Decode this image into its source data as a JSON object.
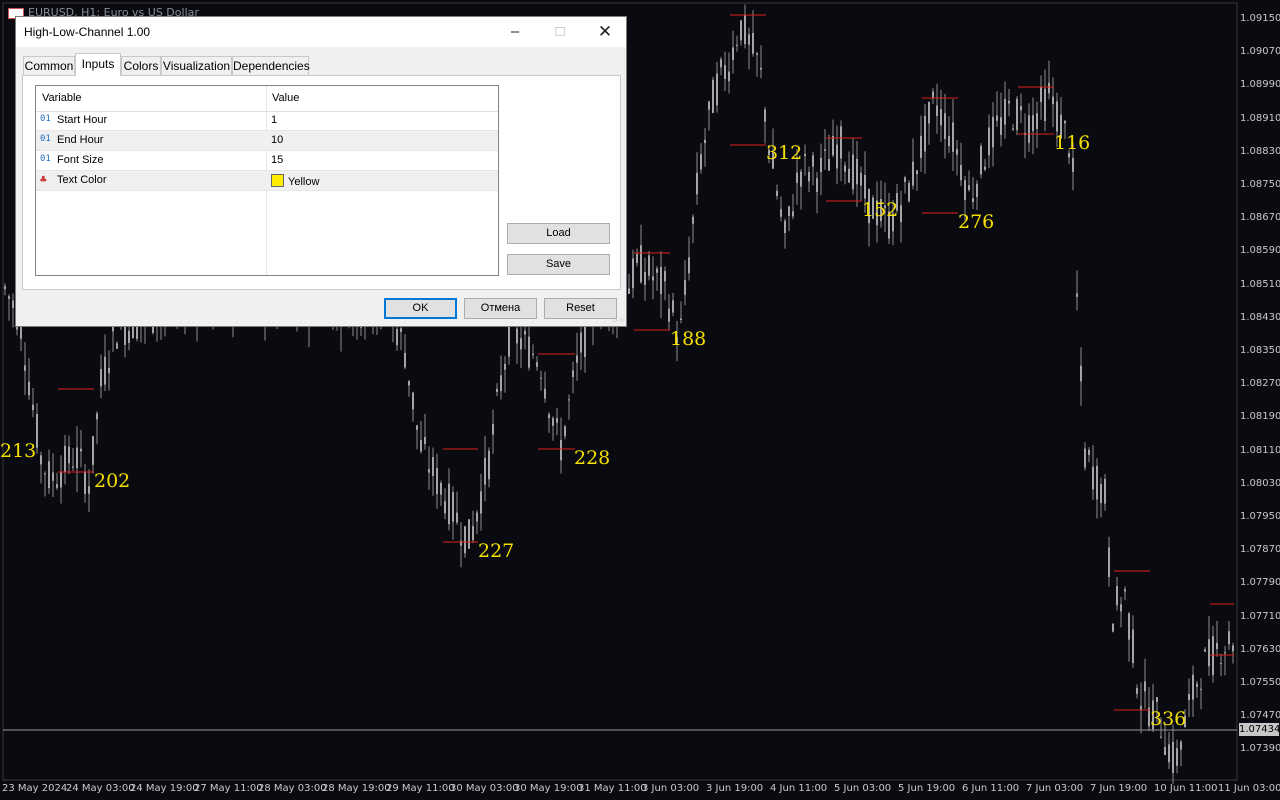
{
  "chart": {
    "window_title": "EURUSD, H1: Euro vs US Dollar",
    "current_price": "1.07434",
    "y_ticks": [
      "1.09150",
      "1.09070",
      "1.08990",
      "1.08910",
      "1.08830",
      "1.08750",
      "1.08670",
      "1.08590",
      "1.08510",
      "1.08430",
      "1.08350",
      "1.08270",
      "1.08190",
      "1.08110",
      "1.08030",
      "1.07950",
      "1.07870",
      "1.07790",
      "1.07710",
      "1.07630",
      "1.07550",
      "1.07470",
      "1.07390"
    ],
    "x_ticks": [
      "23 May 2024",
      "24 May 03:00",
      "24 May 19:00",
      "27 May 11:00",
      "28 May 03:00",
      "28 May 19:00",
      "29 May 11:00",
      "30 May 03:00",
      "30 May 19:00",
      "31 May 11:00",
      "3 Jun 03:00",
      "3 Jun 19:00",
      "4 Jun 11:00",
      "5 Jun 03:00",
      "5 Jun 19:00",
      "6 Jun 11:00",
      "7 Jun 03:00",
      "7 Jun 19:00",
      "10 Jun 11:00",
      "11 Jun 03:00"
    ],
    "range_labels": [
      "213",
      "202",
      "227",
      "228",
      "188",
      "312",
      "152",
      "276",
      "116",
      "336"
    ],
    "label_color": "#f6e000",
    "line_color": "#e0201b"
  },
  "dialog": {
    "title": "High-Low-Channel 1.00",
    "tabs": [
      "Common",
      "Inputs",
      "Colors",
      "Visualization",
      "Dependencies"
    ],
    "active_tab": "Inputs",
    "grid_headers": {
      "variable": "Variable",
      "value": "Value"
    },
    "params": [
      {
        "icon": "01",
        "name": "Start Hour",
        "value": "1"
      },
      {
        "icon": "01",
        "name": "End Hour",
        "value": "10"
      },
      {
        "icon": "01",
        "name": "Font Size",
        "value": "15"
      },
      {
        "icon": "palette",
        "name": "Text Color",
        "value": "Yellow",
        "swatch": "#ffec00"
      }
    ],
    "buttons": {
      "load": "Load",
      "save": "Save",
      "ok": "OK",
      "cancel": "Отмена",
      "reset": "Reset"
    }
  }
}
